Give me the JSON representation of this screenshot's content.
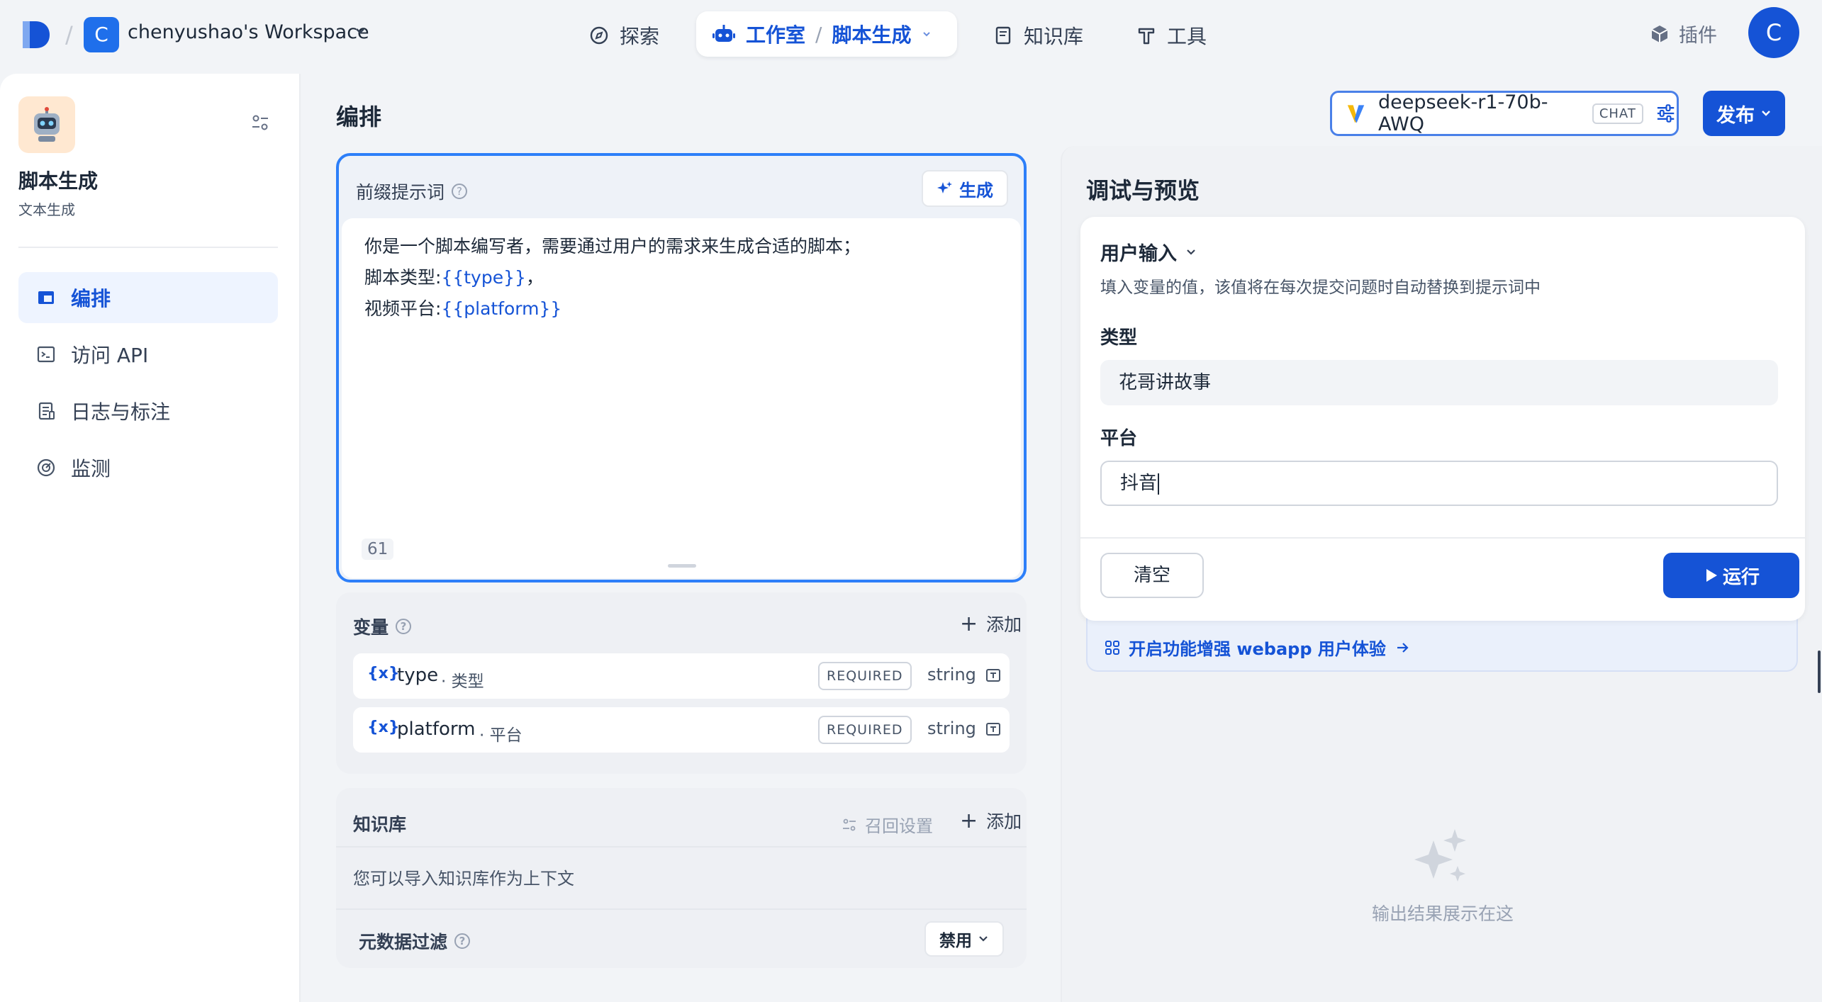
{
  "topbar": {
    "workspace_initial": "C",
    "workspace_name": "chenyushao's Workspace",
    "nav": {
      "explore": "探索",
      "studio": "工作室",
      "current_app": "脚本生成",
      "knowledge": "知识库",
      "tools": "工具"
    },
    "plugins": "插件",
    "user_initial": "C"
  },
  "sidebar": {
    "app_name": "脚本生成",
    "app_type": "文本生成",
    "items": [
      {
        "label": "编排",
        "icon": "layout-icon",
        "active": true
      },
      {
        "label": "访问 API",
        "icon": "terminal-icon",
        "active": false
      },
      {
        "label": "日志与标注",
        "icon": "document-icon",
        "active": false
      },
      {
        "label": "监测",
        "icon": "gauge-icon",
        "active": false
      }
    ]
  },
  "orchestrate": {
    "title": "编排",
    "prompt": {
      "title": "前缀提示词",
      "generate_label": "生成",
      "line1": "你是一个脚本编写者，需要通过用户的需求来生成合适的脚本；",
      "line2_prefix": "脚本类型:",
      "line2_var": "{{type}}",
      "line2_suffix": "，",
      "line3_prefix": "视频平台:",
      "line3_var": "{{platform}}",
      "char_count": "61"
    },
    "variables": {
      "title": "变量",
      "add_label": "添加",
      "items": [
        {
          "icon": "{x}",
          "key": "type",
          "label": "类型",
          "required": "REQUIRED",
          "type": "string"
        },
        {
          "icon": "{x}",
          "key": "platform",
          "label": "平台",
          "required": "REQUIRED",
          "type": "string"
        }
      ]
    },
    "knowledge": {
      "title": "知识库",
      "recall_label": "召回设置",
      "add_label": "添加",
      "description": "您可以导入知识库作为上下文",
      "metadata_filter": "元数据过滤",
      "metadata_filter_value": "禁用"
    }
  },
  "model": {
    "name": "deepseek-r1-70b-AWQ",
    "tag": "CHAT",
    "publish_label": "发布"
  },
  "debug": {
    "title": "调试与预览",
    "user_input_title": "用户输入",
    "user_input_desc": "填入变量的值，该值将在每次提交问题时自动替换到提示词中",
    "fields": [
      {
        "label": "类型",
        "value": "花哥讲故事"
      },
      {
        "label": "平台",
        "value": "抖音"
      }
    ],
    "clear_label": "清空",
    "run_label": "运行",
    "webapp_link": "开启功能增强 webapp 用户体验",
    "empty_text": "输出结果展示在这"
  },
  "colors": {
    "accent": "#1553d6",
    "focus_border": "#2d7ff9",
    "app_icon_bg": "#ffe8d1"
  }
}
